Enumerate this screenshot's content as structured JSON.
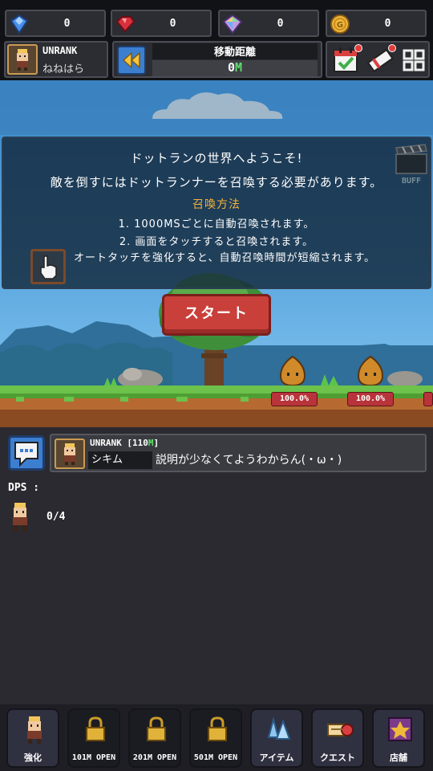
{
  "currencies": [
    {
      "icon": "blue-gem-icon",
      "value": "0",
      "color": "#4a8fe8"
    },
    {
      "icon": "red-gem-icon",
      "value": "0",
      "color": "#d8303d"
    },
    {
      "icon": "rainbow-gem-icon",
      "value": "0",
      "color": "#c59be0"
    },
    {
      "icon": "gold-coin-icon",
      "value": "0",
      "color": "#f0b93a"
    }
  ],
  "player": {
    "rank": "UNRANK",
    "name": "ねねはら"
  },
  "distance": {
    "label": "移動距離",
    "value": "0",
    "unit": "M"
  },
  "welcome": {
    "title": "ドットランの世界へようこそ!",
    "description": "敵を倒すにはドットランナーを召喚する必要があります。",
    "summon_heading": "召喚方法",
    "rule_1": "1. 1000MSごとに自動召喚されます。",
    "rule_2": "2. 画面をタッチすると召喚されます。",
    "auto_touch_text": "オートタッチを強化すると、自動召喚時間が短縮されます。",
    "buff_label": "BUFF"
  },
  "start_button": "スタート",
  "enemies": [
    {
      "hp": "100.0%"
    },
    {
      "hp": "100.0%"
    }
  ],
  "chat": {
    "rank": "UNRANK",
    "rank_distance": "[110",
    "rank_unit": "M",
    "rank_close": "]",
    "user": "シキム",
    "message": "説明が少なくてようわからん(・ω・)"
  },
  "dps_label": "DPS :",
  "unit_count": "0/4",
  "nav": [
    {
      "label": "強化",
      "icon": "hero-icon",
      "locked": false
    },
    {
      "label": "101M OPEN",
      "icon": "lock-icon",
      "locked": true
    },
    {
      "label": "201M OPEN",
      "icon": "lock-icon",
      "locked": true
    },
    {
      "label": "501M OPEN",
      "icon": "lock-icon",
      "locked": true
    },
    {
      "label": "アイテム",
      "icon": "crystal-icon",
      "locked": false
    },
    {
      "label": "クエスト",
      "icon": "scroll-icon",
      "locked": false
    },
    {
      "label": "店舗",
      "icon": "shop-icon",
      "locked": false
    }
  ],
  "colors": {
    "accent_green": "#5de06a",
    "start_red": "#c9403a",
    "summon_orange": "#f5b33a"
  }
}
